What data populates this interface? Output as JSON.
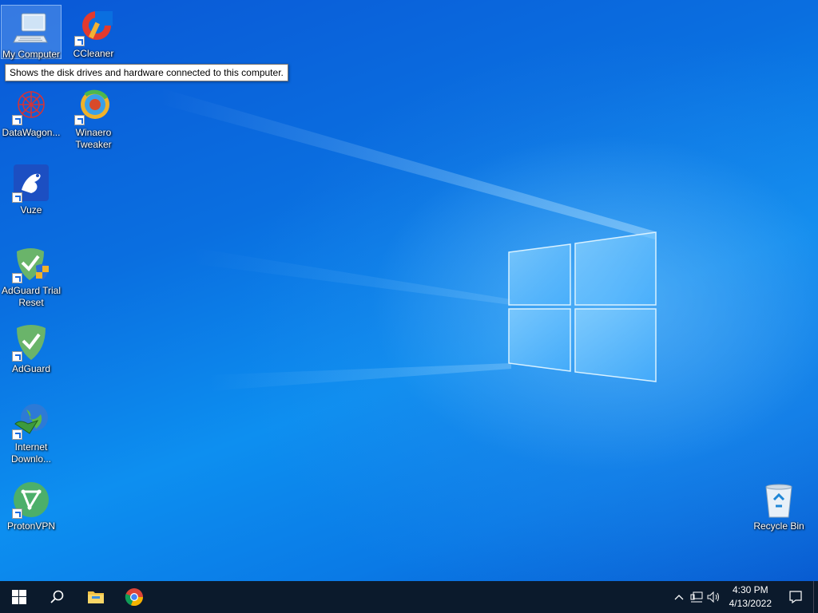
{
  "desktop": {
    "icons": [
      {
        "label": "My Computer"
      },
      {
        "label": "CCleaner"
      },
      {
        "label": "DataWagon..."
      },
      {
        "label": "Winaero Tweaker"
      },
      {
        "label": "Vuze"
      },
      {
        "label": "AdGuard Trial Reset"
      },
      {
        "label": "AdGuard"
      },
      {
        "label": "Internet Downlo..."
      },
      {
        "label": "ProtonVPN"
      },
      {
        "label": "Recycle Bin"
      }
    ],
    "tooltip": "Shows the disk drives and hardware connected to this computer."
  },
  "taskbar": {
    "clock_time": "4:30 PM",
    "clock_date": "4/13/2022"
  },
  "colors": {
    "taskbar_bg": "#0b1a2c",
    "accent": "#0a6fe0"
  }
}
